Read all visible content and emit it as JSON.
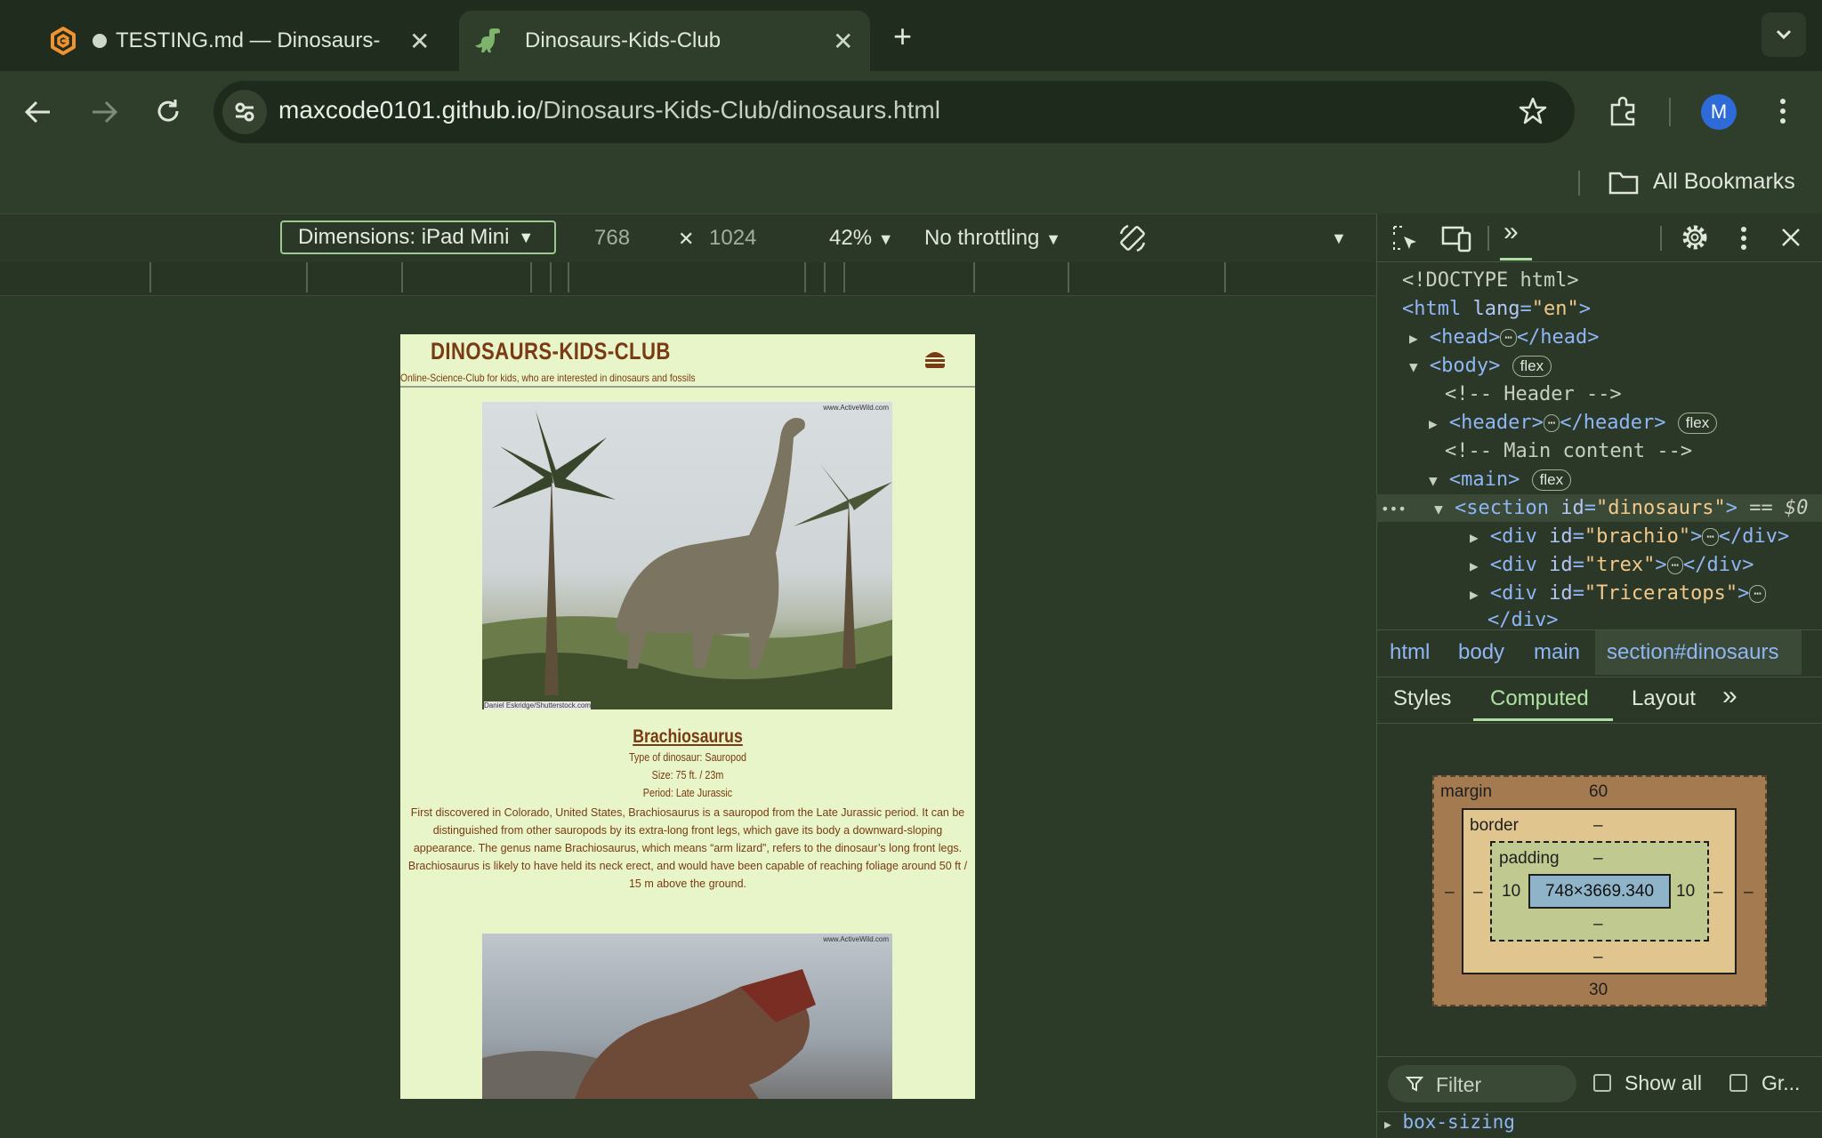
{
  "browser": {
    "tabs": [
      {
        "title": "TESTING.md — Dinosaurs-",
        "close": "✕"
      },
      {
        "title": "Dinosaurs-Kids-Club",
        "close": "✕"
      }
    ],
    "new_tab": "+",
    "url_host": "maxcode0101.github.io",
    "url_path": "/Dinosaurs-Kids-Club/dinosaurs.html",
    "profile_initial": "M",
    "bookmarks_label": "All Bookmarks"
  },
  "device_toolbar": {
    "dimensions": "Dimensions: iPad Mini",
    "width": "768",
    "times": "✕",
    "height": "1024",
    "zoom": "42%",
    "throttling": "No throttling"
  },
  "site": {
    "title": "DINOSAURS-KIDS-CLUB",
    "subtitle": "Online-Science-Club for kids, who are interested in dinosaurs and fossils",
    "watermark": "www.ActiveWild.com",
    "credit": "Daniel Eskridge/Shutterstock.com",
    "dino": {
      "name": "Brachiosaurus",
      "type": "Type of dinosaur: Sauropod",
      "size": "Size: 75 ft. / 23m",
      "period": "Period: Late Jurassic",
      "description": "First discovered in Colorado, United States, Brachiosaurus is a sauropod from the Late Jurassic period. It can be distinguished from other sauropods by its extra-long front legs, which gave its body a downward-sloping appearance. The genus name Brachiosaurus, which means “arm lizard”, refers to the dinosaur’s long front legs. Brachiosaurus is likely to have held its neck erect, and would have been capable of reaching foliage around 50 ft / 15 m above the ground."
    }
  },
  "devtools": {
    "elements": {
      "doctype": "<!DOCTYPE html>",
      "html_open": "<html",
      "lang_attr": "lang",
      "lang_val": "\"en\"",
      "head": "<head>",
      "head_close": "</head>",
      "body": "<body>",
      "flex": "flex",
      "comment_header": "<!-- Header -->",
      "header": "<header>",
      "header_close": "</header>",
      "comment_main": "<!-- Main content -->",
      "main": "<main>",
      "section_open": "<section",
      "id_attr": "id",
      "section_id": "\"dinosaurs\"",
      "section_marker": "== $0",
      "div_open": "<div",
      "div_brachio": "\"brachio\"",
      "div_trex": "\"trex\"",
      "div_triceratops": "\"Triceratops\"",
      "div_close": "</div>",
      "ellipsis": "⋯"
    },
    "breadcrumbs": [
      "html",
      "body",
      "main",
      "section#dinosaurs"
    ],
    "panes": [
      "Styles",
      "Computed",
      "Layout"
    ],
    "box_model": {
      "margin_label": "margin",
      "margin_top": "60",
      "margin_bottom": "30",
      "margin_left": "–",
      "margin_right": "–",
      "border_label": "border",
      "border_top": "–",
      "border_bottom": "–",
      "border_left": "–",
      "border_right": "–",
      "padding_label": "padding",
      "padding_top": "–",
      "padding_bottom": "–",
      "padding_left": "10",
      "padding_right": "10",
      "content": "748×3669.340"
    },
    "filter_placeholder": "Filter",
    "show_all": "Show all",
    "group": "Gr...",
    "property": "box-sizing"
  }
}
